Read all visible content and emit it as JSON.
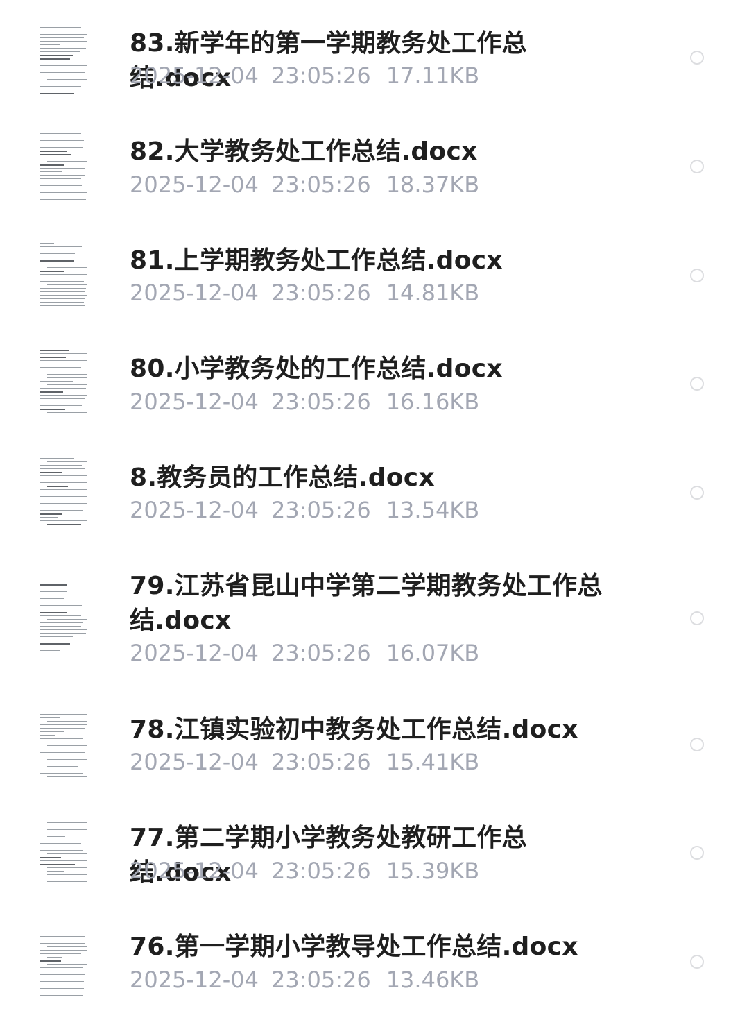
{
  "files": [
    {
      "name": "83.新学年的第一学期教务处工作总结.docx",
      "date": "2025-12-04",
      "time": "23:05:26",
      "size": "17.11KB",
      "icon": "docx-thumbnail-icon",
      "selected": false
    },
    {
      "name": "82.大学教务处工作总结.docx",
      "date": "2025-12-04",
      "time": "23:05:26",
      "size": "18.37KB",
      "icon": "docx-thumbnail-icon",
      "selected": false
    },
    {
      "name": "81.上学期教务处工作总结.docx",
      "date": "2025-12-04",
      "time": "23:05:26",
      "size": "14.81KB",
      "icon": "docx-thumbnail-icon",
      "selected": false
    },
    {
      "name": "80.小学教务处的工作总结.docx",
      "date": "2025-12-04",
      "time": "23:05:26",
      "size": "16.16KB",
      "icon": "docx-thumbnail-icon",
      "selected": false
    },
    {
      "name": "8.教务员的工作总结.docx",
      "date": "2025-12-04",
      "time": "23:05:26",
      "size": "13.54KB",
      "icon": "docx-thumbnail-icon",
      "selected": false
    },
    {
      "name": "79.江苏省昆山中学第二学期教务处工作总结.docx",
      "date": "2025-12-04",
      "time": "23:05:26",
      "size": "16.07KB",
      "icon": "docx-thumbnail-icon",
      "selected": false
    },
    {
      "name": "78.江镇实验初中教务处工作总结.docx",
      "date": "2025-12-04",
      "time": "23:05:26",
      "size": "15.41KB",
      "icon": "docx-thumbnail-icon",
      "selected": false
    },
    {
      "name": "77.第二学期小学教务处教研工作总结.docx",
      "date": "2025-12-04",
      "time": "23:05:26",
      "size": "15.39KB",
      "icon": "docx-thumbnail-icon",
      "selected": false
    },
    {
      "name": "76.第一学期小学教导处工作总结.docx",
      "date": "2025-12-04",
      "time": "23:05:26",
      "size": "13.46KB",
      "icon": "docx-thumbnail-icon",
      "selected": false
    }
  ],
  "colors": {
    "name_text": "#1f1f1f",
    "meta_text": "#a3a7b3",
    "radio_border": "#dcdde0",
    "thumb_line": "#9aa0a6"
  }
}
